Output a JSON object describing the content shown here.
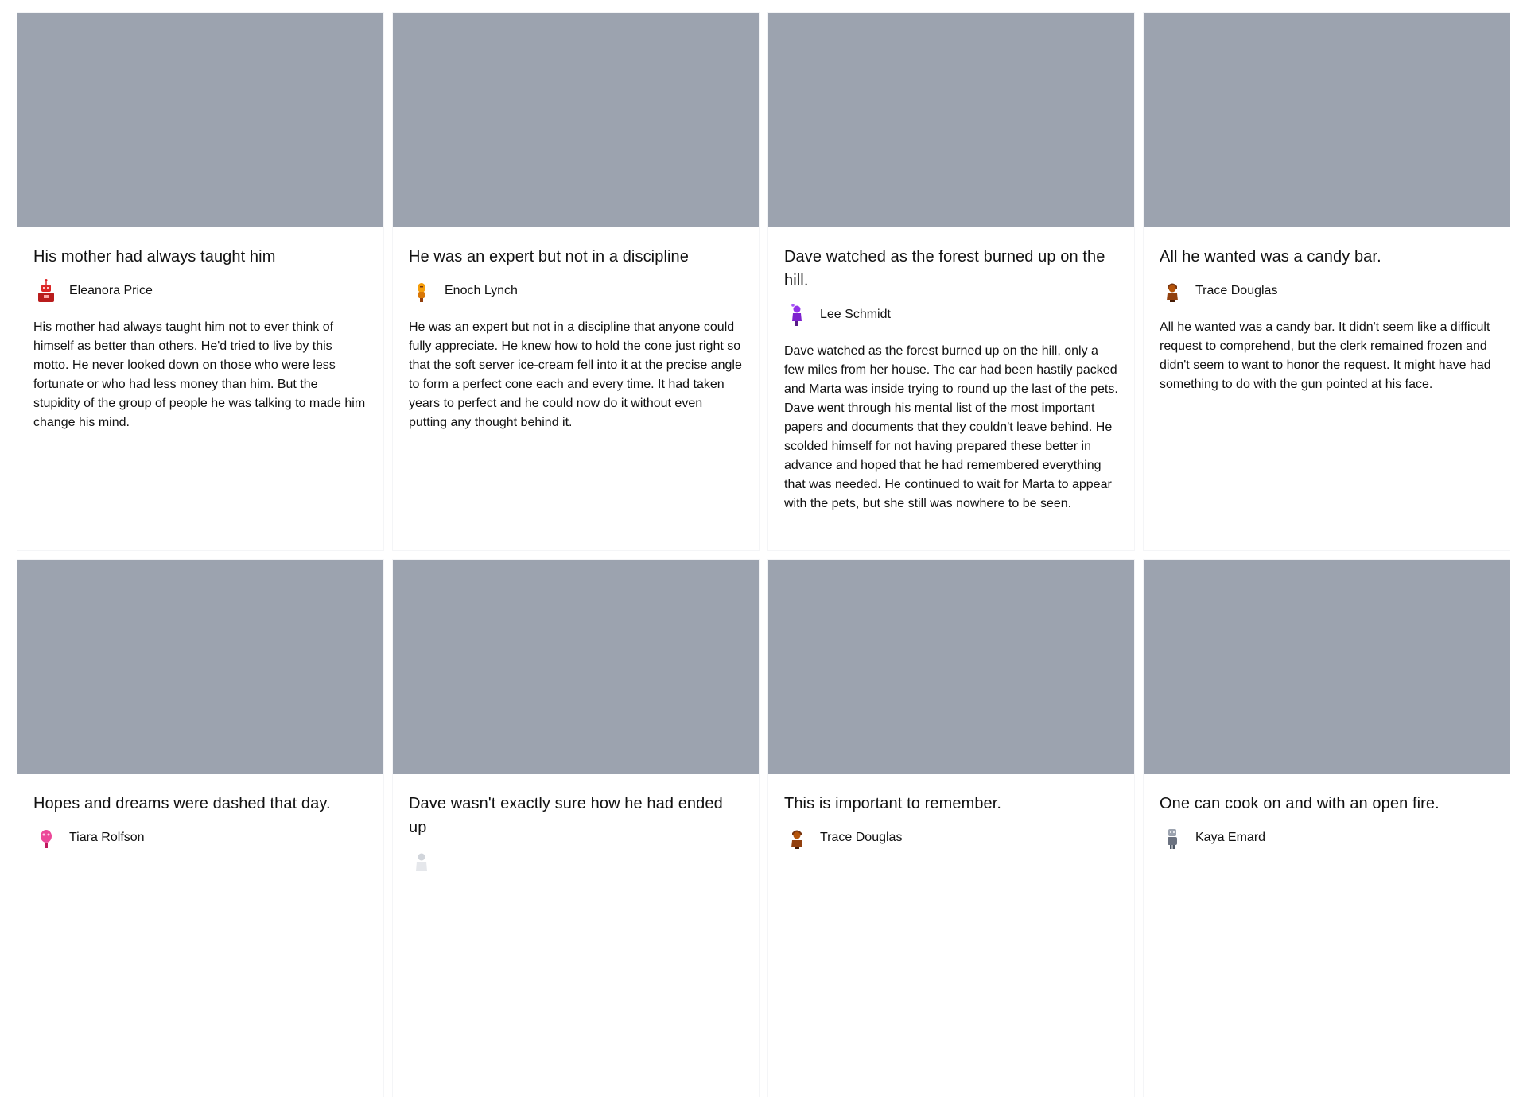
{
  "cards": [
    {
      "title": "His mother had always taught him",
      "author": "Eleanora Price",
      "avatar_icon": "red-robot-avatar-icon",
      "avatar_color": "#dc2626",
      "excerpt": "His mother had always taught him not to ever think of himself as better than others. He'd tried to live by this motto. He never looked down on those who were less fortunate or who had less money than him. But the stupidity of the group of people he was talking to made him change his mind."
    },
    {
      "title": "He was an expert but not in a discipline",
      "author": "Enoch Lynch",
      "avatar_icon": "orange-figure-avatar-icon",
      "avatar_color": "#f59e0b",
      "excerpt": "He was an expert but not in a discipline that anyone could fully appreciate. He knew how to hold the cone just right so that the soft server ice-cream fell into it at the precise angle to form a perfect cone each and every time. It had taken years to perfect and he could now do it without even putting any thought behind it."
    },
    {
      "title": "Dave watched as the forest burned up on the hill.",
      "author": "Lee Schmidt",
      "avatar_icon": "purple-figure-avatar-icon",
      "avatar_color": "#7e22ce",
      "excerpt": "Dave watched as the forest burned up on the hill, only a few miles from her house. The car had been hastily packed and Marta was inside trying to round up the last of the pets. Dave went through his mental list of the most important papers and documents that they couldn't leave behind. He scolded himself for not having prepared these better in advance and hoped that he had remembered everything that was needed. He continued to wait for Marta to appear with the pets, but she still was nowhere to be seen."
    },
    {
      "title": "All he wanted was a candy bar.",
      "author": "Trace Douglas",
      "avatar_icon": "brown-figure-avatar-icon",
      "avatar_color": "#92400e",
      "excerpt": "All he wanted was a candy bar. It didn't seem like a difficult request to comprehend, but the clerk remained frozen and didn't seem to want to honor the request. It might have had something to do with the gun pointed at his face."
    },
    {
      "title": "Hopes and dreams were dashed that day.",
      "author": "Tiara Rolfson",
      "avatar_icon": "pink-figure-avatar-icon",
      "avatar_color": "#db2777",
      "excerpt": ""
    },
    {
      "title": "Dave wasn't exactly sure how he had ended up",
      "author": "",
      "avatar_icon": "gray-figure-avatar-icon",
      "avatar_color": "#d1d5db",
      "excerpt": ""
    },
    {
      "title": "This is important to remember.",
      "author": "Trace Douglas",
      "avatar_icon": "brown-figure-avatar-icon",
      "avatar_color": "#92400e",
      "excerpt": ""
    },
    {
      "title": "One can cook on and with an open fire.",
      "author": "Kaya Emard",
      "avatar_icon": "gray-robot-avatar-icon",
      "avatar_color": "#9ca3af",
      "excerpt": ""
    }
  ]
}
